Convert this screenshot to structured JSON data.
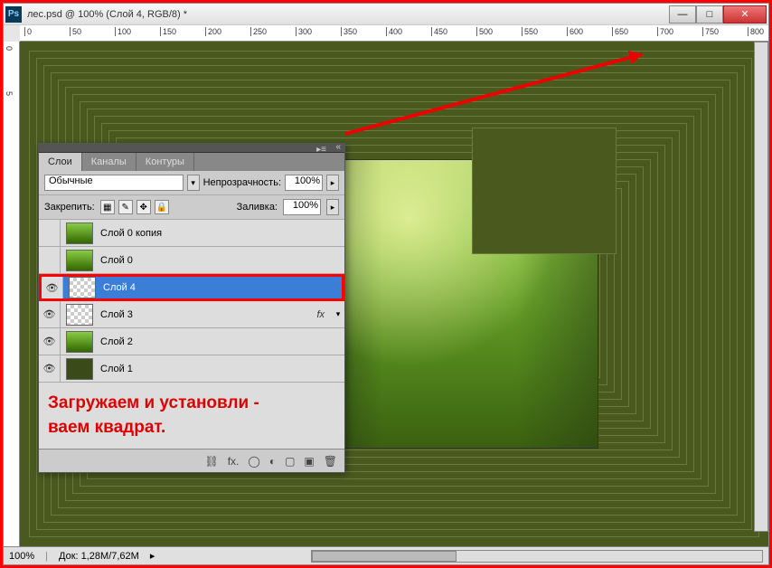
{
  "window": {
    "title": "лес.psd @ 100% (Слой 4, RGB/8) *",
    "ps_badge": "Ps"
  },
  "ruler_ticks": [
    "0",
    "50",
    "100",
    "150",
    "200",
    "250",
    "300",
    "350",
    "400",
    "450",
    "500",
    "550",
    "600",
    "650",
    "700",
    "750",
    "800"
  ],
  "ruler_v_ticks": [
    "0",
    "5"
  ],
  "layers_panel": {
    "tabs": {
      "layers": "Слои",
      "channels": "Каналы",
      "paths": "Контуры"
    },
    "blend_mode": "Обычные",
    "opacity_label": "Непрозрачность:",
    "opacity_value": "100%",
    "lock_label": "Закрепить:",
    "fill_label": "Заливка:",
    "fill_value": "100%",
    "layers": [
      {
        "name": "Слой 0 копия",
        "visible": false,
        "thumb": "forest",
        "selected": false
      },
      {
        "name": "Слой 0",
        "visible": false,
        "thumb": "forest",
        "selected": false
      },
      {
        "name": "Слой 4",
        "visible": true,
        "thumb": "checker",
        "selected": true,
        "highlight": true
      },
      {
        "name": "Слой 3",
        "visible": true,
        "thumb": "checker",
        "selected": false,
        "fx": "fx"
      },
      {
        "name": "Слой 2",
        "visible": true,
        "thumb": "forest",
        "selected": false
      },
      {
        "name": "Слой 1",
        "visible": true,
        "thumb": "dark",
        "selected": false
      }
    ]
  },
  "annotation": {
    "line1": "Загружаем и установли -",
    "line2": "ваем квадрат."
  },
  "footer_icons": {
    "link": "⛓",
    "fx": "fx.",
    "mask": "◯",
    "adj": "◐",
    "folder": "▢",
    "new": "▣",
    "trash": "🗑"
  },
  "statusbar": {
    "zoom": "100%",
    "doc": "Док: 1,28M/7,62M"
  }
}
